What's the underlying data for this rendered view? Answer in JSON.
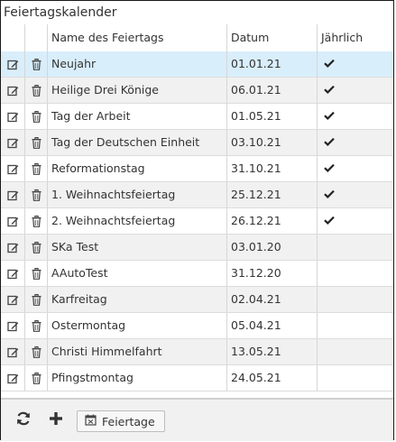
{
  "panel": {
    "title": "Feiertagskalender"
  },
  "columns": {
    "name": "Name des Feiertags",
    "date": "Datum",
    "yearly": "Jährlich"
  },
  "rows": [
    {
      "name": "Neujahr",
      "date": "01.01.21",
      "yearly": true,
      "selected": true
    },
    {
      "name": "Heilige Drei Könige",
      "date": "06.01.21",
      "yearly": true
    },
    {
      "name": "Tag der Arbeit",
      "date": "01.05.21",
      "yearly": true
    },
    {
      "name": "Tag der Deutschen Einheit",
      "date": "03.10.21",
      "yearly": true
    },
    {
      "name": "Reformationstag",
      "date": "31.10.21",
      "yearly": true
    },
    {
      "name": "1. Weihnachtsfeiertag",
      "date": "25.12.21",
      "yearly": true
    },
    {
      "name": "2. Weihnachtsfeiertag",
      "date": "26.12.21",
      "yearly": true
    },
    {
      "name": "SKa Test",
      "date": "03.01.20",
      "yearly": false
    },
    {
      "name": "AAutoTest",
      "date": "31.12.20",
      "yearly": false
    },
    {
      "name": "Karfreitag",
      "date": "02.04.21",
      "yearly": false
    },
    {
      "name": "Ostermontag",
      "date": "05.04.21",
      "yearly": false
    },
    {
      "name": "Christi Himmelfahrt",
      "date": "13.05.21",
      "yearly": false
    },
    {
      "name": "Pfingstmontag",
      "date": "24.05.21",
      "yearly": false
    }
  ],
  "icons": {
    "edit": "edit-icon",
    "delete": "trash-icon",
    "check": "check-icon",
    "refresh": "refresh-icon",
    "add": "plus-icon",
    "calendar": "calendar-icon"
  },
  "footer": {
    "holidays_button": "Feiertage"
  },
  "colors": {
    "selected_row": "#d9eefb",
    "alt_row": "#f1f1f1",
    "border": "#d6d6d6"
  }
}
